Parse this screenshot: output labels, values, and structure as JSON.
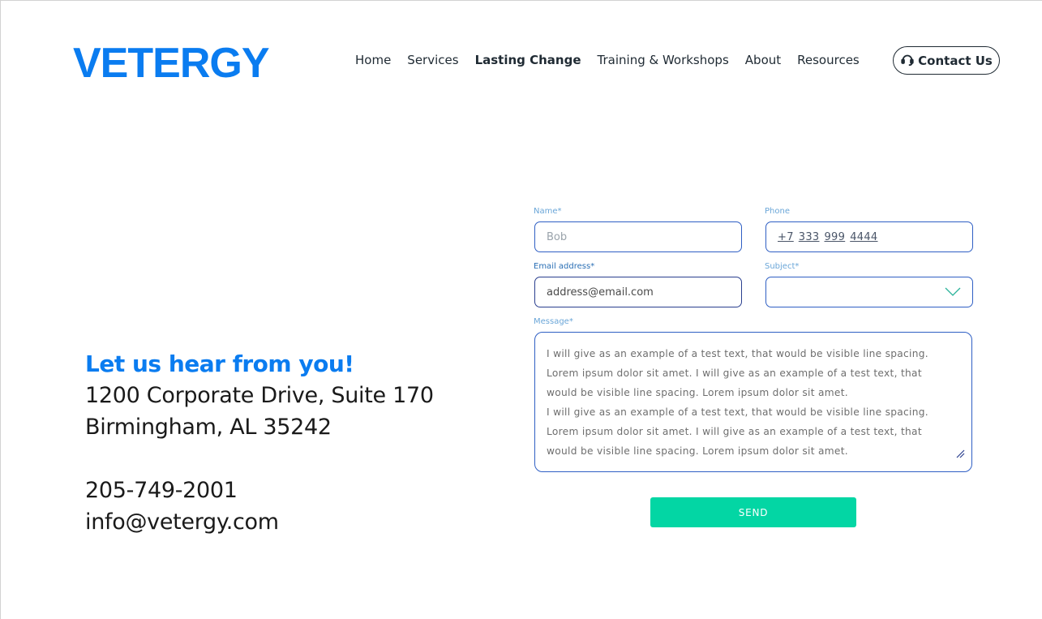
{
  "brand": {
    "logo_text": "VETERGY",
    "accent_color": "#0a7cf0"
  },
  "nav": {
    "items": [
      {
        "label": "Home"
      },
      {
        "label": "Services"
      },
      {
        "label": "Lasting Change",
        "active": true
      },
      {
        "label": "Training & Workshops"
      },
      {
        "label": "About"
      },
      {
        "label": "Resources"
      }
    ],
    "contact_label": "Contact Us",
    "contact_icon": "headset-icon"
  },
  "info": {
    "headline": "Let us hear from you!",
    "address_line1": "1200 Corporate Drive, Suite 170",
    "address_line2": "Birmingham, AL 35242",
    "phone": "205-749-2001",
    "email": "info@vetergy.com"
  },
  "form": {
    "name": {
      "label": "Name*",
      "placeholder": "Bob"
    },
    "phone": {
      "label": "Phone",
      "parts": [
        "+7",
        "333",
        "999",
        "4444"
      ]
    },
    "email": {
      "label": "Email address*",
      "value": "address@email.com"
    },
    "subject": {
      "label": "Subject*",
      "value": "",
      "icon": "chevron-down-icon"
    },
    "message": {
      "label": "Message*",
      "lines": [
        "I will give as an example of a test text, that would be visible line spacing.",
        "Lorem ipsum dolor sit amet. I will give as an example of a test text, that",
        "would be visible line spacing. Lorem ipsum dolor sit amet.",
        "I will give as an example of a test text, that would be visible line spacing.",
        "Lorem ipsum dolor sit amet. I will give as an example of a test text, that",
        "would be visible line spacing. Lorem ipsum dolor sit amet."
      ]
    },
    "send_label": "SEND",
    "send_color": "#03d6a4"
  }
}
